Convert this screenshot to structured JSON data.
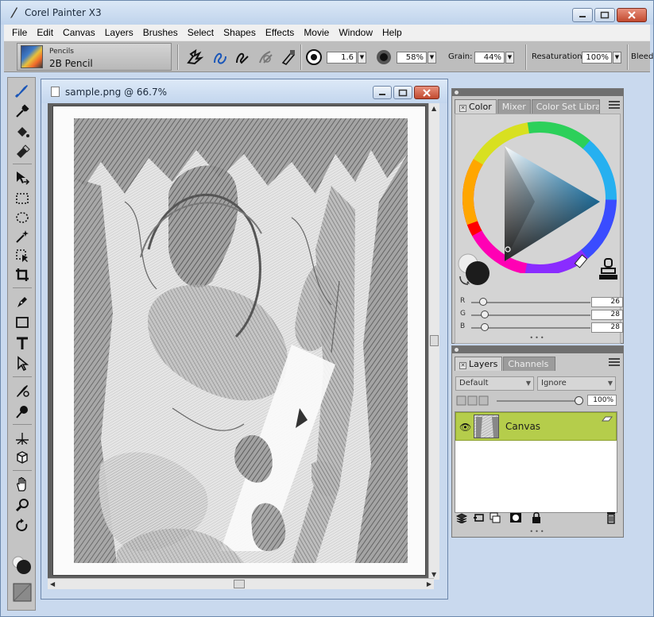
{
  "window": {
    "title": "Corel Painter X3"
  },
  "menu": [
    "File",
    "Edit",
    "Canvas",
    "Layers",
    "Brushes",
    "Select",
    "Shapes",
    "Effects",
    "Movie",
    "Window",
    "Help"
  ],
  "property_bar": {
    "brush_category": "Pencils",
    "brush_variant": "2B Pencil",
    "size_value": "1.6",
    "opacity_value": "58%",
    "grain_label": "Grain:",
    "grain_value": "44%",
    "resaturation_label": "Resaturation:",
    "resaturation_value": "100%",
    "bleed_label": "Bleed"
  },
  "document": {
    "title": "sample.png @ 66.7%"
  },
  "color_panel": {
    "tabs": [
      "Color",
      "Mixer",
      "Color Set Librarie"
    ],
    "active_tab": "Color",
    "rgb": [
      {
        "label": "R",
        "value": "26",
        "fraction": 0.1
      },
      {
        "label": "G",
        "value": "28",
        "fraction": 0.11
      },
      {
        "label": "B",
        "value": "28",
        "fraction": 0.11
      }
    ],
    "main_color": "#1c1c1c",
    "secondary_color": "#eeeeee"
  },
  "layers_panel": {
    "tabs": [
      "Layers",
      "Channels"
    ],
    "active_tab": "Layers",
    "composite_method": "Default",
    "composite_depth": "Ignore",
    "opacity": "100%",
    "layers": [
      {
        "name": "Canvas",
        "selected": true
      }
    ],
    "selection_color": "#b5cd4b"
  }
}
